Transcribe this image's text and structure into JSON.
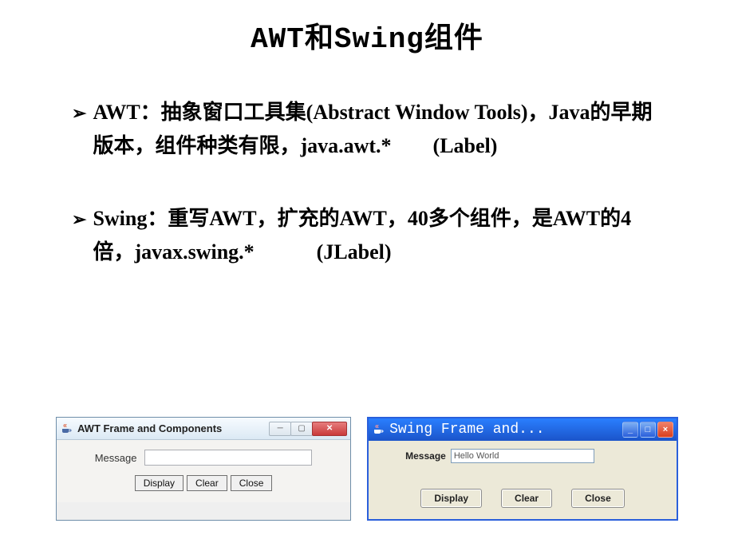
{
  "title": "AWT和Swing组件",
  "bullets": [
    "AWT：抽象窗口工具集(Abstract Window Tools)，Java的早期版本，组件种类有限，java.awt.*　　(Label)",
    "Swing：重写AWT，扩充的AWT，40多个组件，是AWT的4倍，javax.swing.*　　　(JLabel)"
  ],
  "awt_window": {
    "title": "AWT Frame and Components",
    "field_label": "Message",
    "field_value": "",
    "buttons": {
      "display": "Display",
      "clear": "Clear",
      "close": "Close"
    }
  },
  "swing_window": {
    "title": "Swing Frame and...",
    "field_label": "Message",
    "field_value": "Hello World",
    "buttons": {
      "display": "Display",
      "clear": "Clear",
      "close": "Close"
    }
  }
}
